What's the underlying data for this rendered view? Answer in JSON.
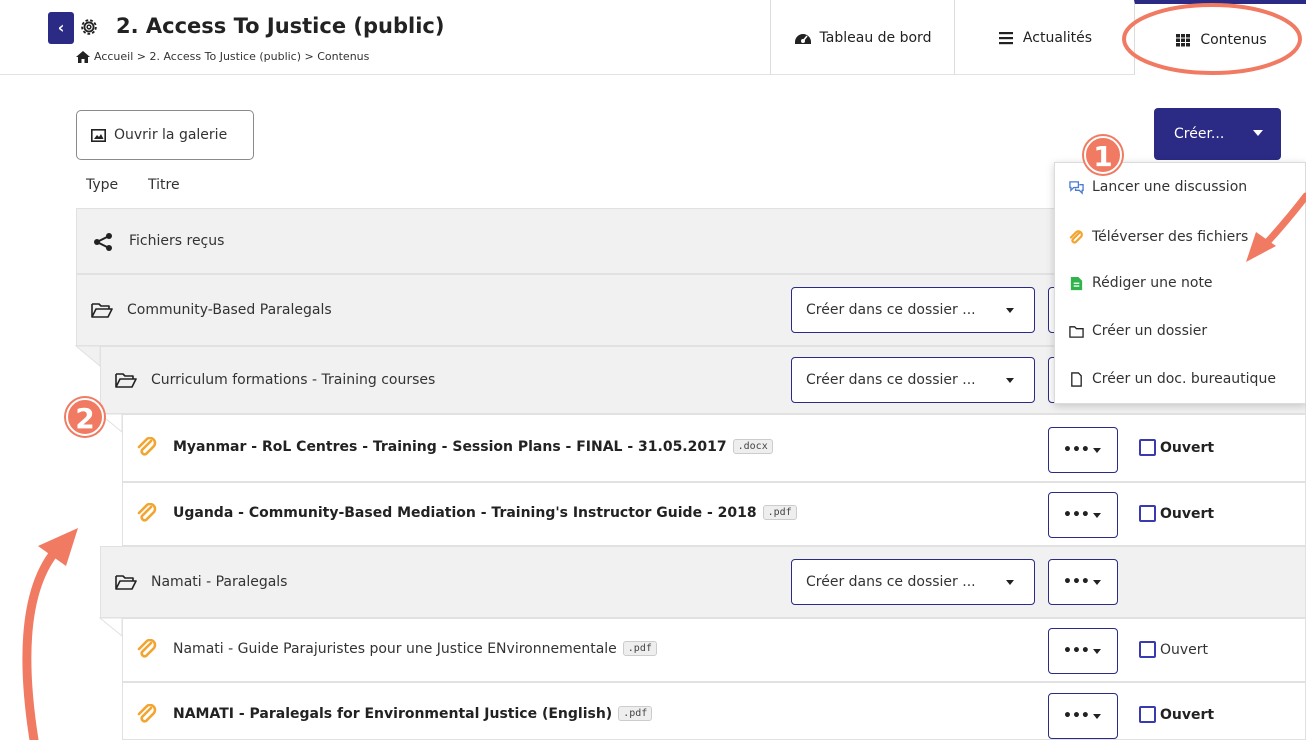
{
  "header": {
    "back_glyph": "‹",
    "title": "2. Access To Justice (public)",
    "breadcrumb": "Accueil > 2. Access To Justice (public) > Contenus"
  },
  "tabs": [
    {
      "label": "Tableau de bord",
      "icon": "dashboard-icon"
    },
    {
      "label": "Actualités",
      "icon": "menu-lines-icon"
    },
    {
      "label": "Contenus",
      "icon": "grid-icon",
      "active": true
    }
  ],
  "toolbar": {
    "gallery_label": "Ouvrir la galerie",
    "create_label": "Créer..."
  },
  "columns": {
    "type": "Type",
    "title": "Titre"
  },
  "rows": [
    {
      "label": "Fichiers reçus",
      "kind": "share"
    },
    {
      "label": "Community-Based Paralegals",
      "kind": "folder",
      "select_label": "Créer dans ce dossier ..."
    },
    {
      "label": "Curriculum formations - Training courses",
      "kind": "folder",
      "select_label": "Créer dans ce dossier ..."
    },
    {
      "label": "Myanmar - RoL Centres - Training - Session Plans - FINAL - 31.05.2017",
      "ext": ".docx",
      "kind": "file",
      "check_label": "Ouvert"
    },
    {
      "label": "Uganda - Community-Based Mediation - Training's Instructor Guide - 2018",
      "ext": ".pdf",
      "kind": "file",
      "check_label": "Ouvert"
    },
    {
      "label": "Namati - Paralegals",
      "kind": "folder",
      "select_label": "Créer dans ce dossier ..."
    },
    {
      "label": "Namati - Guide Parajuristes pour une Justice ENvironnementale",
      "ext": ".pdf",
      "kind": "file",
      "check_label": "Ouvert"
    },
    {
      "label": "NAMATI - Paralegals for Environmental Justice (English)",
      "ext": ".pdf",
      "kind": "file",
      "check_label": "Ouvert"
    }
  ],
  "dots_label": "•••",
  "menu": [
    {
      "label": "Lancer une discussion",
      "icon": "discussion-icon"
    },
    {
      "label": "Téléverser des fichiers",
      "icon": "paperclip-icon"
    },
    {
      "label": "Rédiger une note",
      "icon": "note-icon"
    },
    {
      "label": "Créer un dossier",
      "icon": "folder-icon"
    },
    {
      "label": "Créer un doc. bureautique",
      "icon": "document-icon"
    }
  ],
  "annotations": {
    "one": "1",
    "two": "2"
  },
  "colors": {
    "primary": "#2b2a85",
    "annotation": "#f07a62",
    "file_icon": "#f2a531"
  }
}
